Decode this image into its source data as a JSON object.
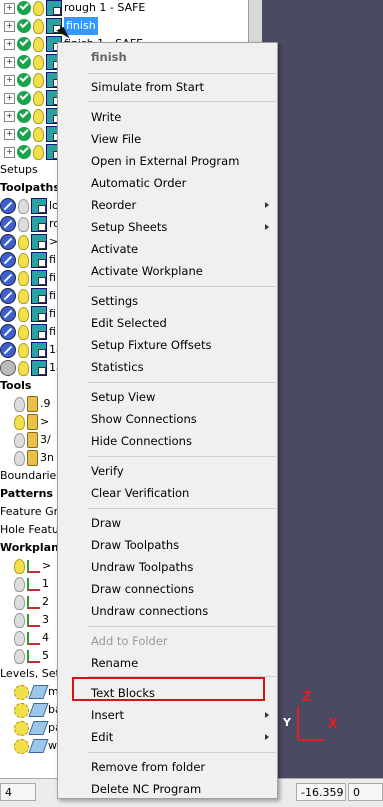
{
  "tree": {
    "top_rows": [
      {
        "label": "rough 1 - SAFE"
      },
      {
        "label": "finish"
      },
      {
        "label": "finish 1 - SAFE"
      }
    ],
    "section_labels": {
      "setups": "Setups",
      "toolpaths": "Toolpaths",
      "tools": "Tools",
      "boundaries": "Boundaries",
      "patterns": "Patterns",
      "feature_groups": "Feature Gro",
      "hole_features": "Hole Featur",
      "workplanes": "Workplane",
      "levels": "Levels, Sets"
    },
    "toolpath_items": [
      "lo",
      "ro",
      ">",
      "fi",
      "fi",
      "fi",
      "fi",
      "fi",
      "18"
    ],
    "tool_items": [
      ".9",
      ">",
      "3/",
      "3n"
    ],
    "workplane_items": [
      ">",
      "1",
      "2",
      "3",
      "4",
      "5"
    ],
    "level_items": [
      "m",
      "ba",
      "pa",
      "w"
    ]
  },
  "status_bar": {
    "left_value": "4",
    "coord": "-16.359",
    "right_value": "0"
  },
  "viewport": {
    "axis_z": "Z",
    "axis_x": "X",
    "axis_y": "Y",
    "colors": {
      "background": "#4a4a62",
      "axis": "#e02020"
    }
  },
  "context_menu": {
    "header": "finish",
    "items": {
      "simulate": "Simulate from Start",
      "write": "Write",
      "view_file": "View File",
      "open_external": "Open in External Program",
      "automatic_order": "Automatic Order",
      "reorder": "Reorder",
      "setup_sheets": "Setup Sheets",
      "activate": "Activate",
      "activate_workplane": "Activate Workplane",
      "settings": "Settings",
      "edit_selected": "Edit Selected",
      "fixture_offsets": "Setup Fixture Offsets",
      "statistics": "Statistics",
      "setup_view": "Setup View",
      "show_connections": "Show Connections",
      "hide_connections": "Hide Connections",
      "verify": "Verify",
      "clear_verification": "Clear Verification",
      "draw": "Draw",
      "draw_toolpaths": "Draw Toolpaths",
      "undraw_toolpaths": "Undraw Toolpaths",
      "draw_connections": "Draw connections",
      "undraw_connections": "Undraw connections",
      "add_to_folder": "Add to Folder",
      "rename": "Rename",
      "text_blocks": "Text Blocks",
      "insert": "Insert",
      "edit": "Edit",
      "remove_from_folder": "Remove from folder",
      "delete_nc": "Delete NC Program"
    },
    "highlight_color": "#d41414"
  }
}
